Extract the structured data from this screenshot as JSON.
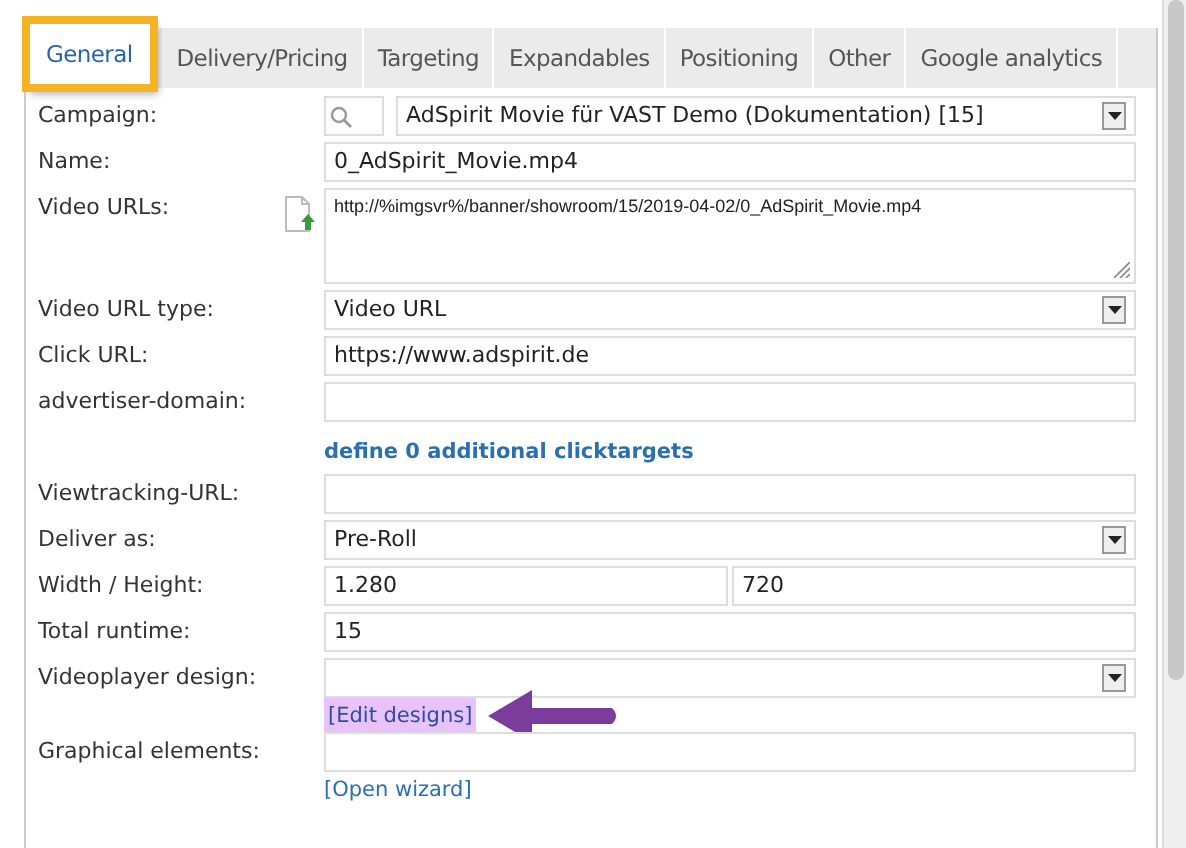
{
  "tabs": [
    {
      "label": "General",
      "selected": true
    },
    {
      "label": "Delivery/Pricing",
      "selected": false
    },
    {
      "label": "Targeting",
      "selected": false
    },
    {
      "label": "Expandables",
      "selected": false
    },
    {
      "label": "Positioning",
      "selected": false
    },
    {
      "label": "Other",
      "selected": false
    },
    {
      "label": "Google analytics",
      "selected": false
    }
  ],
  "form": [
    {
      "kind": "search_select",
      "label": "Campaign:",
      "value": "AdSpirit Movie für VAST Demo (Dokumentation) [15]"
    },
    {
      "kind": "text",
      "label": "Name:",
      "value": "0_AdSpirit_Movie.mp4"
    },
    {
      "kind": "textarea",
      "label": "Video URLs:",
      "value": "http://%imgsvr%/banner/showroom/15/2019-04-02/0_AdSpirit_Movie.mp4"
    },
    {
      "kind": "select",
      "label": "Video URL type:",
      "value": "Video URL"
    },
    {
      "kind": "text",
      "label": "Click URL:",
      "value": "https://www.adspirit.de"
    },
    {
      "kind": "text",
      "label": "advertiser-domain:"
    },
    {
      "kind": "link",
      "text": "define 0 additional clicktargets"
    },
    {
      "kind": "text",
      "label": "Viewtracking-URL:"
    },
    {
      "kind": "select",
      "label": "Deliver as:",
      "value": "Pre-Roll"
    },
    {
      "kind": "pair",
      "label": "Width / Height:",
      "values": [
        "1.280",
        "720"
      ]
    },
    {
      "kind": "text",
      "label": "Total runtime:",
      "value": "15"
    },
    {
      "kind": "select",
      "label": "Videoplayer design:",
      "link": {
        "text": "[Edit designs]",
        "highlighted": true
      }
    },
    {
      "kind": "text",
      "label": "Graphical elements:",
      "link": {
        "text": "[Open wizard]",
        "highlighted": false
      }
    }
  ]
}
